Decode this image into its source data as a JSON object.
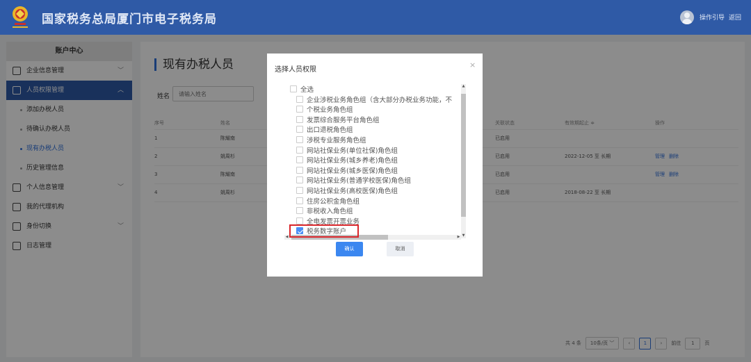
{
  "header": {
    "title": "国家税务总局厦门市电子税务局",
    "guide_label": "操作引导",
    "back_label": "返回",
    "emblem_text": "国徽税徽"
  },
  "sidebar": {
    "heading": "账户中心",
    "items": [
      {
        "label": "企业信息管理",
        "icon": "building-icon",
        "expanded": false
      },
      {
        "label": "人员权限管理",
        "icon": "user-lock-icon",
        "expanded": true,
        "active": true
      },
      {
        "label": "个人信息管理",
        "icon": "id-card-icon",
        "expanded": false
      },
      {
        "label": "我的代理机构",
        "icon": "agency-icon"
      },
      {
        "label": "身份切换",
        "icon": "switch-icon",
        "expanded": false
      },
      {
        "label": "日志管理",
        "icon": "log-icon"
      }
    ],
    "sub_items": [
      {
        "label": "添加办税人员"
      },
      {
        "label": "待确认办税人员"
      },
      {
        "label": "现有办税人员",
        "current": true
      },
      {
        "label": "历史管理信息"
      }
    ]
  },
  "main": {
    "title": "现有办税人员",
    "search_label": "姓名",
    "search_placeholder": "请输入姓名",
    "columns": [
      "序号",
      "姓名",
      "关联状态",
      "有效期起止 ≑",
      "操作"
    ],
    "rows": [
      {
        "no": "1",
        "name": "陈耀南",
        "status": "已启用",
        "period": "",
        "ops": []
      },
      {
        "no": "2",
        "name": "姚周杉",
        "status": "已启用",
        "period": "2022-12-05 至 长期",
        "ops": [
          "管理",
          "删除"
        ]
      },
      {
        "no": "3",
        "name": "陈耀南",
        "status": "已启用",
        "period": "",
        "ops": [
          "管理",
          "删除"
        ]
      },
      {
        "no": "4",
        "name": "姚周杉",
        "status": "已启用",
        "period": "2018-08-22 至 长期",
        "ops": []
      }
    ],
    "pager": {
      "total": "共 4 条",
      "page_size": "10条/页",
      "current_page": "1",
      "goto_label": "前往",
      "goto_value": "1",
      "page_unit": "页"
    }
  },
  "modal": {
    "title": "选择人员权限",
    "close": "×",
    "options": [
      {
        "label": "全选",
        "checked": false,
        "level": 0
      },
      {
        "label": "企业涉税业务角色组（含大部分办税业务功能，不",
        "checked": false,
        "level": 1
      },
      {
        "label": "个税业务角色组",
        "checked": false,
        "level": 1
      },
      {
        "label": "发票综合服务平台角色组",
        "checked": false,
        "level": 1
      },
      {
        "label": "出口退税角色组",
        "checked": false,
        "level": 1
      },
      {
        "label": "涉税专业服务角色组",
        "checked": false,
        "level": 1
      },
      {
        "label": "网站社保业务(单位社保)角色组",
        "checked": false,
        "level": 1
      },
      {
        "label": "网站社保业务(城乡养老)角色组",
        "checked": false,
        "level": 1
      },
      {
        "label": "网站社保业务(城乡医保)角色组",
        "checked": false,
        "level": 1
      },
      {
        "label": "网站社保业务(普通学校医保)角色组",
        "checked": false,
        "level": 1
      },
      {
        "label": "网站社保业务(高校医保)角色组",
        "checked": false,
        "level": 1
      },
      {
        "label": "住房公积金角色组",
        "checked": false,
        "level": 1
      },
      {
        "label": "非税收入角色组",
        "checked": false,
        "level": 1
      },
      {
        "label": "全电发票开票业务",
        "checked": false,
        "level": 1
      },
      {
        "label": "税务数字账户",
        "checked": true,
        "level": 1
      }
    ],
    "confirm_label": "确认",
    "cancel_label": "取消"
  },
  "colors": {
    "header_bg": "#2f5aa6",
    "accent": "#2f6fd9",
    "highlight": "#d9262b",
    "confirm_bg": "#3b87f0"
  }
}
